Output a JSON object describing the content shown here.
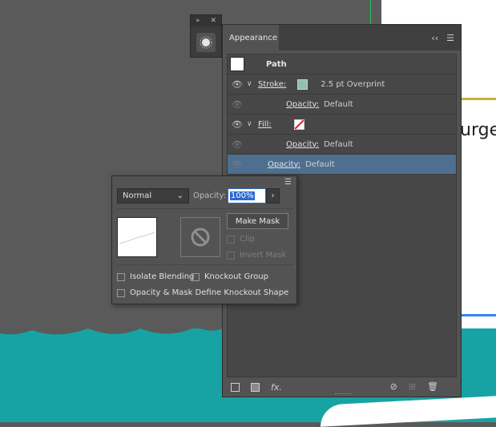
{
  "background": {
    "canvas_text": "urge"
  },
  "mini_panel": {
    "icon": "appearance-sun-icon"
  },
  "appearance": {
    "tab_title": "Appearance",
    "header_icons": [
      "collapse-icon",
      "panel-menu-icon"
    ],
    "rows": [
      {
        "type": "path",
        "label": "Path"
      },
      {
        "type": "stroke",
        "label": "Stroke:",
        "value": "2.5 pt Overprint",
        "swatch_color": "#8fbfb5"
      },
      {
        "type": "opacity",
        "label": "Opacity:",
        "value": "Default"
      },
      {
        "type": "fill",
        "label": "Fill:",
        "value": ""
      },
      {
        "type": "opacity",
        "label": "Opacity:",
        "value": "Default"
      },
      {
        "type": "opacity-selected",
        "label": "Opacity:",
        "value": "Default"
      }
    ],
    "footer_icons": [
      "add-stroke-icon",
      "add-fill-icon",
      "fx-icon",
      "clear-appearance-icon",
      "duplicate-item-icon",
      "delete-icon"
    ],
    "fx_label": "fx."
  },
  "transparency": {
    "blend_mode": "Normal",
    "opacity_label": "Opacity:",
    "opacity_value": "100%",
    "make_mask_label": "Make Mask",
    "clip_label": "Clip",
    "invert_mask_label": "Invert Mask",
    "isolate_blending_label": "Isolate Blending",
    "knockout_group_label": "Knockout Group",
    "opacity_mask_label": "Opacity & Mask Define Knockout Shape"
  },
  "colors": {
    "selected_row": "#4e6f8f",
    "teal": "#17a3a3",
    "stroke_swatch": "#8fbfb5"
  }
}
